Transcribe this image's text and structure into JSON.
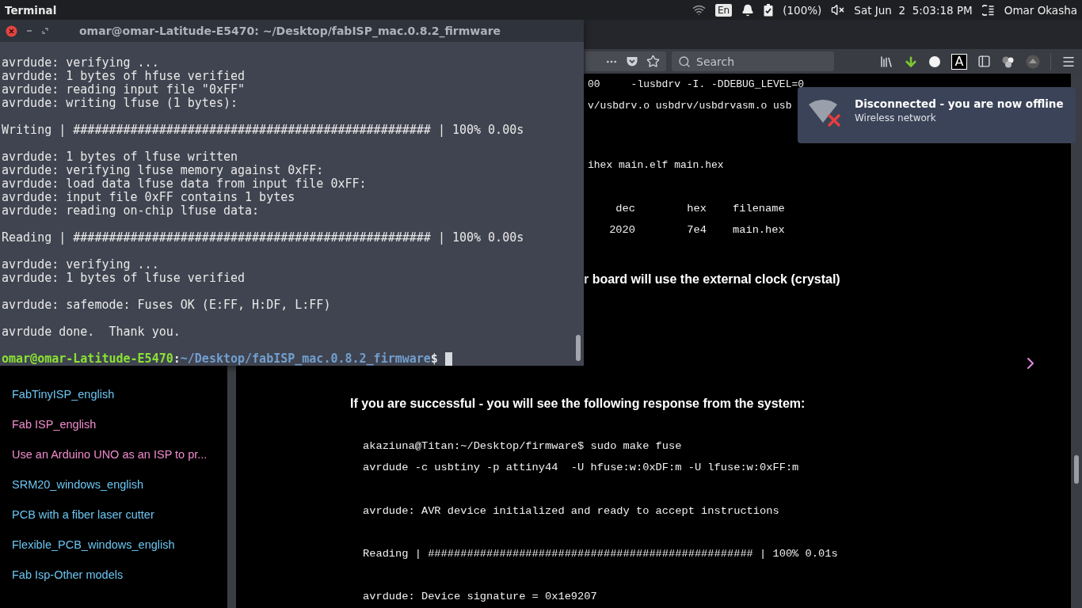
{
  "top_bar": {
    "app_name": "Terminal",
    "keyboard_layout": "En",
    "battery": "(100%)",
    "clock": "Sat Jun  2  5:03:18 PM",
    "user": "Omar Okasha"
  },
  "browser": {
    "toolbar": {
      "search_placeholder": "Search",
      "reader_badge": "A"
    },
    "sidebar": {
      "items": [
        {
          "label": "FabTinyISP_english",
          "color": "#6cc6f2"
        },
        {
          "label": "Fab ISP_english",
          "color": "#f28ccc"
        },
        {
          "label": "Use an Arduino UNO as an ISP to pr...",
          "color": "#f28ccc"
        },
        {
          "label": "SRM20_windows_english",
          "color": "#6cc6f2"
        },
        {
          "label": "PCB with a fiber laser cutter",
          "color": "#6cc6f2"
        },
        {
          "label": "Flexible_PCB_windows_english",
          "color": "#6cc6f2"
        },
        {
          "label": "Fab Isp-Other models",
          "color": "#6cc6f2"
        }
      ]
    },
    "content": [
      {
        "kind": "fragment",
        "lines": [
          "00     -lusbdrv -I. -DDEBUG_LEVEL=0",
          "v/usbdrv.o usbdrv/usbdrvasm.o usb"
        ]
      },
      {
        "kind": "fragment",
        "lines": [
          "ihex main.elf main.hex"
        ]
      },
      {
        "kind": "table",
        "rows": [
          [
            "dec",
            "hex",
            "filename"
          ],
          [
            "2020",
            "7e4",
            "main.hex"
          ]
        ]
      },
      {
        "kind": "note",
        "lines": [
          "r board will use the external clock (crystal)"
        ]
      },
      {
        "kind": "next"
      },
      {
        "kind": "heading",
        "lines": [
          "If you are successful - you will see the following response from the system:"
        ]
      },
      {
        "kind": "code",
        "lines": [
          "akaziuna@Titan:~/Desktop/firmware$ sudo make fuse",
          "avrdude -c usbtiny -p attiny44  -U hfuse:w:0xDF:m -U lfuse:w:0xFF:m"
        ]
      },
      {
        "kind": "code",
        "lines": [
          "avrdude: AVR device initialized and ready to accept instructions"
        ]
      },
      {
        "kind": "code",
        "lines": [
          "Reading | ################################################## | 100% 0.01s"
        ]
      },
      {
        "kind": "code",
        "lines": [
          "avrdude: Device signature = 0x1e9207"
        ]
      }
    ]
  },
  "terminal": {
    "title": "omar@omar-Latitude-E5470: ~/Desktop/fabISP_mac.0.8.2_firmware",
    "blocks": [
      [
        "avrdude: verifying ...",
        "avrdude: 1 bytes of hfuse verified",
        "avrdude: reading input file \"0xFF\"",
        "avrdude: writing lfuse (1 bytes):"
      ],
      [
        "Writing | ################################################## | 100% 0.00s"
      ],
      [
        "avrdude: 1 bytes of lfuse written",
        "avrdude: verifying lfuse memory against 0xFF:",
        "avrdude: load data lfuse data from input file 0xFF:",
        "avrdude: input file 0xFF contains 1 bytes",
        "avrdude: reading on-chip lfuse data:"
      ],
      [
        "Reading | ################################################## | 100% 0.00s"
      ],
      [
        "avrdude: verifying ...",
        "avrdude: 1 bytes of lfuse verified"
      ],
      [
        "avrdude: safemode: Fuses OK (E:FF, H:DF, L:FF)"
      ],
      [
        "avrdude done.  Thank you."
      ]
    ],
    "prompt": {
      "user_host": "omar@omar-Latitude-E5470",
      "separator": ":",
      "path": "~/Desktop/fabISP_mac.0.8.2_firmware",
      "symbol": "$"
    }
  },
  "notification": {
    "title": "Disconnected - you are now offline",
    "body": "Wireless network"
  }
}
